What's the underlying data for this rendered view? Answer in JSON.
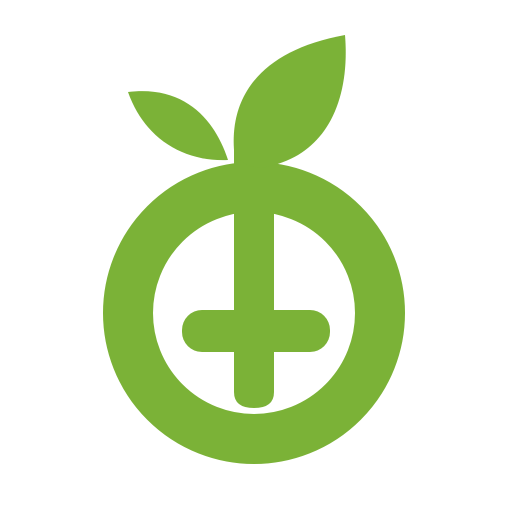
{
  "icon": "health-plant-plus-logo-icon",
  "colors": {
    "background": "#ffffff",
    "brand_green": "#7bb237"
  }
}
